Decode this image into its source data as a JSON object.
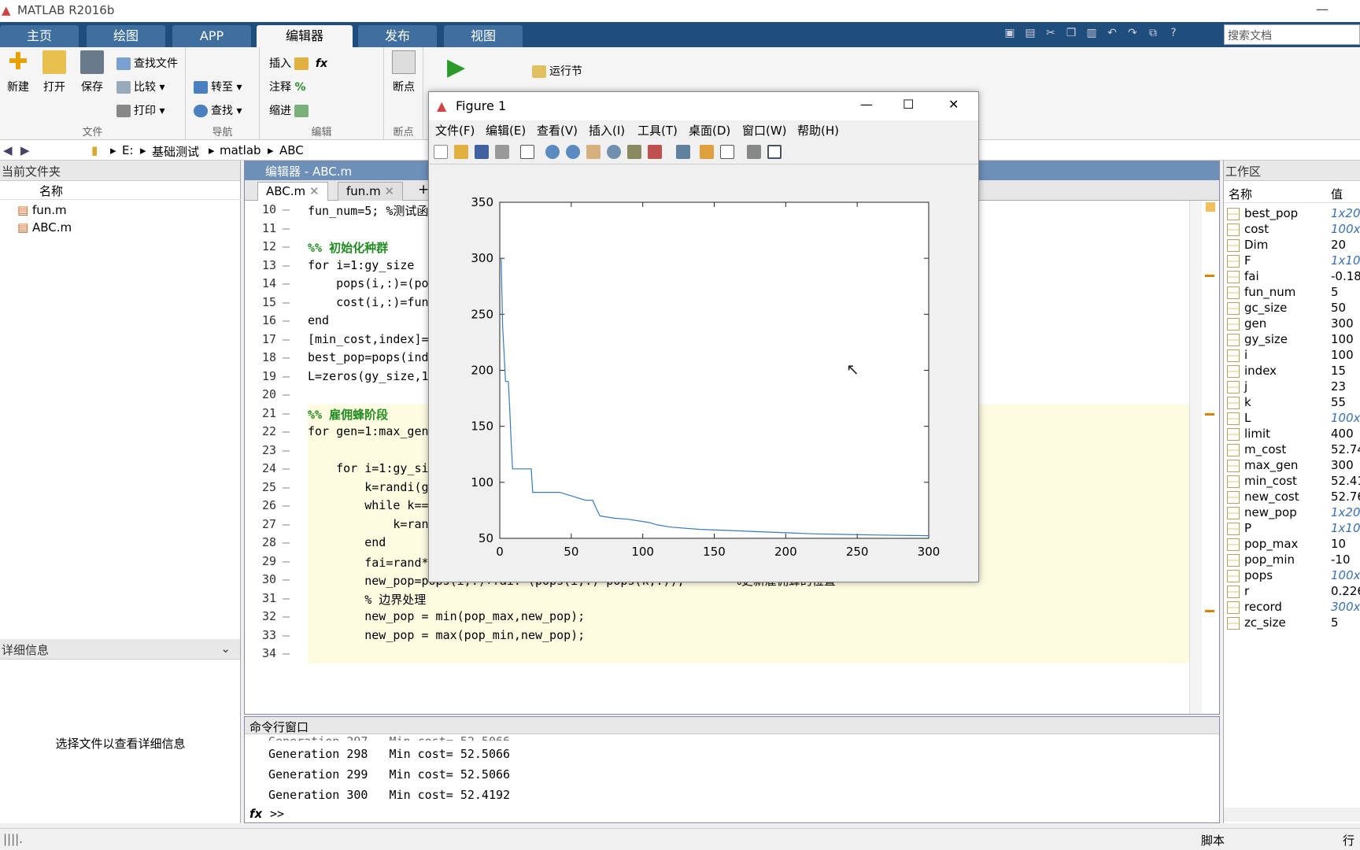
{
  "app": {
    "title": "MATLAB R2016b",
    "min": "—",
    "max": "☐",
    "close": "✕"
  },
  "tabs": [
    "主页",
    "绘图",
    "APP",
    "编辑器",
    "发布",
    "视图"
  ],
  "search": {
    "placeholder": "搜索文档"
  },
  "ribbon": {
    "file": {
      "label": "文件",
      "new": "新建",
      "open": "打开",
      "save": "保存",
      "find_files": "查找文件",
      "compare": "比较",
      "print": "打印"
    },
    "nav": {
      "label": "导航",
      "goto": "转至",
      "find": "查找"
    },
    "edit": {
      "label": "编辑",
      "insert": "插入",
      "comment": "注释",
      "indent": "缩进"
    },
    "bp": {
      "label": "断点",
      "bp": "断点"
    },
    "run": {
      "run_section": "运行节"
    }
  },
  "address": {
    "parts": [
      "E:",
      "基础测试",
      "matlab",
      "ABC"
    ]
  },
  "current_folder": {
    "title": "当前文件夹",
    "col_name": "名称",
    "files": [
      "fun.m",
      "ABC.m"
    ]
  },
  "details": {
    "title": "详细信息",
    "hint": "选择文件以查看详细信息"
  },
  "editor": {
    "title": "编辑器 - ABC.m",
    "tabs": [
      "ABC.m",
      "fun.m"
    ],
    "add": "+",
    "lines": [
      {
        "n": "10",
        "t": "fun_num=5; %测试函数",
        "type": "code"
      },
      {
        "n": "11",
        "t": "",
        "type": "code"
      },
      {
        "n": "12",
        "t": "%% 初始化种群",
        "type": "sec"
      },
      {
        "n": "13",
        "t": "for i=1:gy_size",
        "type": "code"
      },
      {
        "n": "14",
        "t": "    pops(i,:)=(po",
        "type": "code"
      },
      {
        "n": "15",
        "t": "    cost(i,:)=fun",
        "type": "code"
      },
      {
        "n": "16",
        "t": "end",
        "type": "code"
      },
      {
        "n": "17",
        "t": "[min_cost,index]=",
        "type": "code"
      },
      {
        "n": "18",
        "t": "best_pop=pops(ind",
        "type": "code"
      },
      {
        "n": "19",
        "t": "L=zeros(gy_size,1",
        "type": "code"
      },
      {
        "n": "20",
        "t": "",
        "type": "code"
      },
      {
        "n": "21",
        "t": "%% 雇佣蜂阶段",
        "type": "sec"
      },
      {
        "n": "22",
        "t": "for gen=1:max_gen",
        "type": "code"
      },
      {
        "n": "23",
        "t": "",
        "type": "code"
      },
      {
        "n": "24",
        "t": "    for i=1:gy_si",
        "type": "code"
      },
      {
        "n": "25",
        "t": "        k=randi(g",
        "type": "code"
      },
      {
        "n": "26",
        "t": "        while k==",
        "type": "code"
      },
      {
        "n": "27",
        "t": "            k=ran",
        "type": "code"
      },
      {
        "n": "28",
        "t": "        end",
        "type": "code"
      },
      {
        "n": "29",
        "t": "        fai=rand*2-1;  %加速系数,取值范围[-1,1]",
        "type": "code"
      },
      {
        "n": "30",
        "t": "        new_pop=pops(i,:)+fai.*(pops(i,:)-pops(k,:));       %更新雇佣蜂的位置",
        "type": "code"
      },
      {
        "n": "31",
        "t": "        % 边界处理",
        "type": "code"
      },
      {
        "n": "32",
        "t": "        new_pop = min(pop_max,new_pop);",
        "type": "code"
      },
      {
        "n": "33",
        "t": "        new_pop = max(pop_min,new_pop);",
        "type": "code"
      },
      {
        "n": "34",
        "t": "",
        "type": "code"
      }
    ]
  },
  "cmd": {
    "title": "命令行窗口",
    "lines": [
      "Generation 297   Min cost= 52.5066",
      "Generation 298   Min cost= 52.5066",
      "Generation 299   Min cost= 52.5066",
      "Generation 300   Min cost= 52.4192"
    ],
    "prompt": ">>",
    "fx": "fx"
  },
  "workspace": {
    "title": "工作区",
    "col_name": "名称",
    "col_value": "值",
    "vars": [
      {
        "n": "best_pop",
        "v": "1x20",
        "it": true
      },
      {
        "n": "cost",
        "v": "100x",
        "it": true
      },
      {
        "n": "Dim",
        "v": "20",
        "it": false
      },
      {
        "n": "F",
        "v": "1x10",
        "it": true
      },
      {
        "n": "fai",
        "v": "-0.18",
        "it": false
      },
      {
        "n": "fun_num",
        "v": "5",
        "it": false
      },
      {
        "n": "gc_size",
        "v": "50",
        "it": false
      },
      {
        "n": "gen",
        "v": "300",
        "it": false
      },
      {
        "n": "gy_size",
        "v": "100",
        "it": false
      },
      {
        "n": "i",
        "v": "100",
        "it": false
      },
      {
        "n": "index",
        "v": "15",
        "it": false
      },
      {
        "n": "j",
        "v": "23",
        "it": false
      },
      {
        "n": "k",
        "v": "55",
        "it": false
      },
      {
        "n": "L",
        "v": "100x",
        "it": true
      },
      {
        "n": "limit",
        "v": "400",
        "it": false
      },
      {
        "n": "m_cost",
        "v": "52.74",
        "it": false
      },
      {
        "n": "max_gen",
        "v": "300",
        "it": false
      },
      {
        "n": "min_cost",
        "v": "52.41",
        "it": false
      },
      {
        "n": "new_cost",
        "v": "52.76",
        "it": false
      },
      {
        "n": "new_pop",
        "v": "1x20",
        "it": true
      },
      {
        "n": "P",
        "v": "1x10",
        "it": true
      },
      {
        "n": "pop_max",
        "v": "10",
        "it": false
      },
      {
        "n": "pop_min",
        "v": "-10",
        "it": false
      },
      {
        "n": "pops",
        "v": "100x",
        "it": true
      },
      {
        "n": "r",
        "v": "0.226",
        "it": false
      },
      {
        "n": "record",
        "v": "300x",
        "it": true
      },
      {
        "n": "zc_size",
        "v": "5",
        "it": false
      }
    ]
  },
  "status": {
    "left": "||||.",
    "mode": "脚本",
    "row": "行"
  },
  "figure": {
    "title": "Figure 1",
    "menus": [
      "文件(F)",
      "编辑(E)",
      "查看(V)",
      "插入(I)",
      "工具(T)",
      "桌面(D)",
      "窗口(W)",
      "帮助(H)"
    ]
  },
  "chart_data": {
    "type": "line",
    "title": "",
    "xlabel": "",
    "ylabel": "",
    "xlim": [
      0,
      300
    ],
    "ylim": [
      50,
      350
    ],
    "xticks": [
      "0",
      "50",
      "100",
      "150",
      "200",
      "250",
      "300"
    ],
    "yticks": [
      "50",
      "100",
      "150",
      "200",
      "250",
      "300",
      "350"
    ],
    "series": [
      {
        "color": "#3a7ab8",
        "x": [
          1,
          2,
          3,
          4,
          5,
          6,
          7,
          8,
          9,
          10,
          11,
          22,
          23,
          40,
          42,
          55,
          60,
          65,
          67,
          70,
          80,
          90,
          100,
          105,
          110,
          120,
          140,
          160,
          180,
          200,
          220,
          240,
          260,
          280,
          300
        ],
        "y": [
          300,
          240,
          215,
          190,
          190,
          190,
          165,
          135,
          112,
          112,
          112,
          112,
          91,
          91,
          91,
          86,
          84,
          84,
          78,
          70,
          68,
          67,
          65,
          64,
          62,
          60,
          58,
          57,
          56,
          55,
          54,
          53.5,
          53,
          52.7,
          52.4
        ]
      }
    ]
  }
}
